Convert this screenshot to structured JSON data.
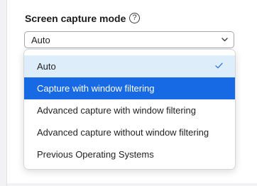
{
  "section": {
    "title": "Screen capture mode",
    "help_icon": "question-circle-icon",
    "help_glyph": "?"
  },
  "select": {
    "value": "Auto",
    "chevron_icon": "chevron-down-icon"
  },
  "dropdown": {
    "options": [
      {
        "label": "Auto",
        "selected": true,
        "checkmark_icon": "checkmark-icon"
      },
      {
        "label": "Capture with window filtering",
        "highlighted": true
      },
      {
        "label": "Advanced capture with window filtering"
      },
      {
        "label": "Advanced capture without window filtering"
      },
      {
        "label": "Previous Operating Systems"
      }
    ]
  },
  "colors": {
    "highlight": "#1769e4",
    "selected_bg": "#ddeefa",
    "checkmark": "#3a7bd5"
  }
}
